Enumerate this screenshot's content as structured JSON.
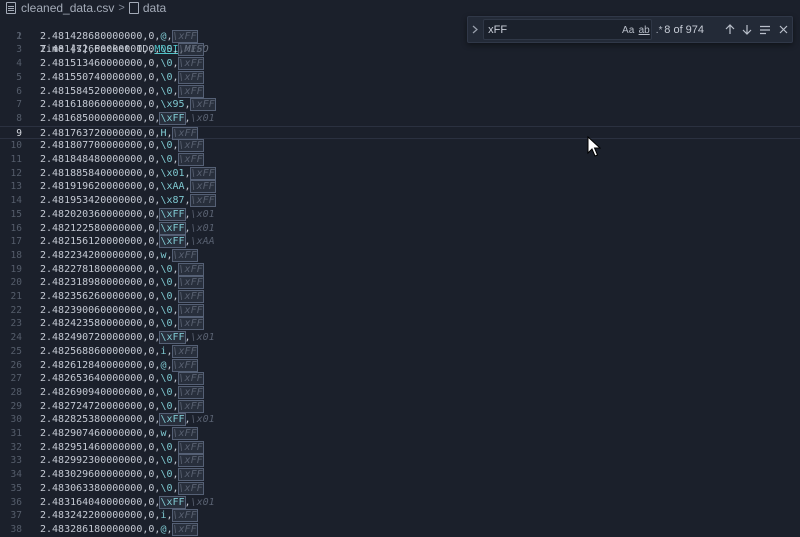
{
  "breadcrumb": {
    "file_name": "cleaned_data.csv",
    "separator": ">",
    "symbol": "data"
  },
  "editor": {
    "current_line": 9,
    "header": {
      "prefix": "Time [s],Packet ID,",
      "mosi": "MOSI",
      "comma": ",",
      "miso": "MISO"
    },
    "rows": [
      {
        "ln": "2",
        "t": "2.481428680000000",
        "id": "0",
        "mosi": "@",
        "miso": "\\xFF"
      },
      {
        "ln": "3",
        "t": "2.481472660000000",
        "id": "0",
        "mosi": "\\0",
        "miso": "\\xFF"
      },
      {
        "ln": "4",
        "t": "2.481513460000000",
        "id": "0",
        "mosi": "\\0",
        "miso": "\\xFF"
      },
      {
        "ln": "5",
        "t": "2.481550740000000",
        "id": "0",
        "mosi": "\\0",
        "miso": "\\xFF"
      },
      {
        "ln": "6",
        "t": "2.481584520000000",
        "id": "0",
        "mosi": "\\0",
        "miso": "\\xFF"
      },
      {
        "ln": "7",
        "t": "2.481618060000000",
        "id": "0",
        "mosi": "\\x95",
        "miso": "\\xFF"
      },
      {
        "ln": "8",
        "t": "2.481685000000000",
        "id": "0",
        "mosi": "\\xFF",
        "miso": "\\x01"
      },
      {
        "ln": "9",
        "t": "2.481763720000000",
        "id": "0",
        "mosi": "H",
        "miso": "\\xFF"
      },
      {
        "ln": "10",
        "t": "2.481807700000000",
        "id": "0",
        "mosi": "\\0",
        "miso": "\\xFF"
      },
      {
        "ln": "11",
        "t": "2.481848480000000",
        "id": "0",
        "mosi": "\\0",
        "miso": "\\xFF"
      },
      {
        "ln": "12",
        "t": "2.481885840000000",
        "id": "0",
        "mosi": "\\x01",
        "miso": "\\xFF"
      },
      {
        "ln": "13",
        "t": "2.481919620000000",
        "id": "0",
        "mosi": "\\xAA",
        "miso": "\\xFF"
      },
      {
        "ln": "14",
        "t": "2.481953420000000",
        "id": "0",
        "mosi": "\\x87",
        "miso": "\\xFF"
      },
      {
        "ln": "15",
        "t": "2.482020360000000",
        "id": "0",
        "mosi": "\\xFF",
        "miso": "\\x01"
      },
      {
        "ln": "16",
        "t": "2.482122580000000",
        "id": "0",
        "mosi": "\\xFF",
        "miso": "\\x01"
      },
      {
        "ln": "17",
        "t": "2.482156120000000",
        "id": "0",
        "mosi": "\\xFF",
        "miso": "\\xAA"
      },
      {
        "ln": "18",
        "t": "2.482234200000000",
        "id": "0",
        "mosi": "w",
        "miso": "\\xFF"
      },
      {
        "ln": "19",
        "t": "2.482278180000000",
        "id": "0",
        "mosi": "\\0",
        "miso": "\\xFF"
      },
      {
        "ln": "20",
        "t": "2.482318980000000",
        "id": "0",
        "mosi": "\\0",
        "miso": "\\xFF"
      },
      {
        "ln": "21",
        "t": "2.482356260000000",
        "id": "0",
        "mosi": "\\0",
        "miso": "\\xFF"
      },
      {
        "ln": "22",
        "t": "2.482390060000000",
        "id": "0",
        "mosi": "\\0",
        "miso": "\\xFF"
      },
      {
        "ln": "23",
        "t": "2.482423580000000",
        "id": "0",
        "mosi": "\\0",
        "miso": "\\xFF"
      },
      {
        "ln": "24",
        "t": "2.482490720000000",
        "id": "0",
        "mosi": "\\xFF",
        "miso": "\\x01"
      },
      {
        "ln": "25",
        "t": "2.482568860000000",
        "id": "0",
        "mosi": "i",
        "miso": "\\xFF"
      },
      {
        "ln": "26",
        "t": "2.482612840000000",
        "id": "0",
        "mosi": "@",
        "miso": "\\xFF"
      },
      {
        "ln": "27",
        "t": "2.482653640000000",
        "id": "0",
        "mosi": "\\0",
        "miso": "\\xFF"
      },
      {
        "ln": "28",
        "t": "2.482690940000000",
        "id": "0",
        "mosi": "\\0",
        "miso": "\\xFF"
      },
      {
        "ln": "29",
        "t": "2.482724720000000",
        "id": "0",
        "mosi": "\\0",
        "miso": "\\xFF"
      },
      {
        "ln": "30",
        "t": "2.482825380000000",
        "id": "0",
        "mosi": "\\xFF",
        "miso": "\\x01"
      },
      {
        "ln": "31",
        "t": "2.482907460000000",
        "id": "0",
        "mosi": "w",
        "miso": "\\xFF"
      },
      {
        "ln": "32",
        "t": "2.482951460000000",
        "id": "0",
        "mosi": "\\0",
        "miso": "\\xFF"
      },
      {
        "ln": "33",
        "t": "2.482992300000000",
        "id": "0",
        "mosi": "\\0",
        "miso": "\\xFF"
      },
      {
        "ln": "34",
        "t": "2.483029600000000",
        "id": "0",
        "mosi": "\\0",
        "miso": "\\xFF"
      },
      {
        "ln": "35",
        "t": "2.483063380000000",
        "id": "0",
        "mosi": "\\0",
        "miso": "\\xFF"
      },
      {
        "ln": "36",
        "t": "2.483164040000000",
        "id": "0",
        "mosi": "\\xFF",
        "miso": "\\x01"
      },
      {
        "ln": "37",
        "t": "2.483242200000000",
        "id": "0",
        "mosi": "i",
        "miso": "\\xFF"
      },
      {
        "ln": "38",
        "t": "2.483286180000000",
        "id": "0",
        "mosi": "@",
        "miso": "\\xFF"
      }
    ]
  },
  "find_widget": {
    "toggle_icon": "chevron-right-icon",
    "search_value": "xFF",
    "match_case_label": "Aa",
    "whole_word_label": "ab",
    "regex_label": ".*",
    "count_text": "8 of 974",
    "prev_icon": "arrow-up-icon",
    "next_icon": "arrow-down-icon",
    "selection_icon": "find-in-selection-icon",
    "close_icon": "close-icon"
  },
  "colors": {
    "background": "#1b202b",
    "mosi": "#7ec8d0",
    "miso": "#586070",
    "match_outline": "#556075"
  }
}
